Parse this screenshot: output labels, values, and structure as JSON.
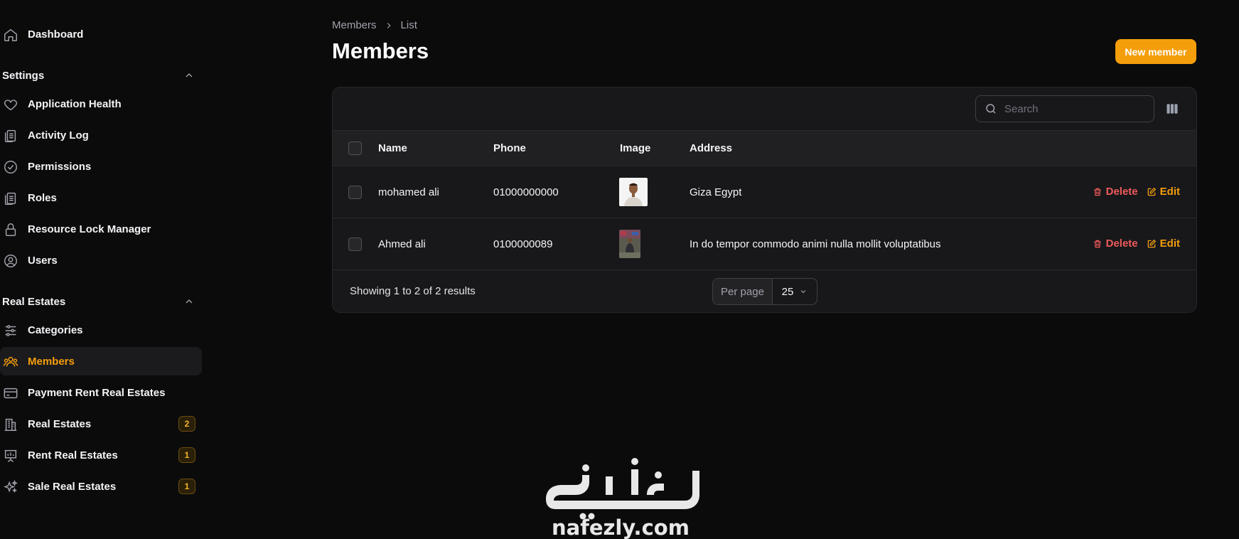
{
  "sidebar": {
    "dashboard": "Dashboard",
    "settings_group": "Settings",
    "settings_items": [
      {
        "label": "Application Health",
        "icon": "heart-icon"
      },
      {
        "label": "Activity Log",
        "icon": "clipboard-icon"
      },
      {
        "label": "Permissions",
        "icon": "check-circle-icon"
      },
      {
        "label": "Roles",
        "icon": "clipboard-icon"
      },
      {
        "label": "Resource Lock Manager",
        "icon": "lock-icon"
      },
      {
        "label": "Users",
        "icon": "user-circle-icon"
      }
    ],
    "realestates_group": "Real Estates",
    "realestates_items": [
      {
        "label": "Categories",
        "icon": "sliders-icon"
      },
      {
        "label": "Members",
        "icon": "users-icon",
        "active": true
      },
      {
        "label": "Payment Rent Real Estates",
        "icon": "credit-card-icon"
      },
      {
        "label": "Real Estates",
        "icon": "building-icon",
        "badge": "2"
      },
      {
        "label": "Rent Real Estates",
        "icon": "presentation-chart-icon",
        "badge": "1"
      },
      {
        "label": "Sale Real Estates",
        "icon": "sparkles-icon",
        "badge": "1"
      }
    ]
  },
  "breadcrumb": [
    "Members",
    "List"
  ],
  "page_title": "Members",
  "new_button": "New member",
  "search": {
    "placeholder": "Search"
  },
  "table": {
    "columns": [
      "Name",
      "Phone",
      "Image",
      "Address"
    ],
    "rows": [
      {
        "name": "mohamed ali",
        "phone": "01000000000",
        "address": "Giza Egypt"
      },
      {
        "name": "Ahmed ali",
        "phone": "0100000089",
        "address": "In do tempor commodo animi nulla mollit voluptatibus"
      }
    ],
    "delete_label": "Delete",
    "edit_label": "Edit"
  },
  "footer": {
    "showing": "Showing 1 to 2 of 2 results",
    "per_page_label": "Per page",
    "per_page_value": "25"
  },
  "watermark": {
    "arabic": "نفذلي",
    "latin": "nafezly.com"
  },
  "colors": {
    "accent": "#f59e0b",
    "danger": "#ef5a5a",
    "background": "#0b0b0c",
    "panel": "#18181b"
  }
}
